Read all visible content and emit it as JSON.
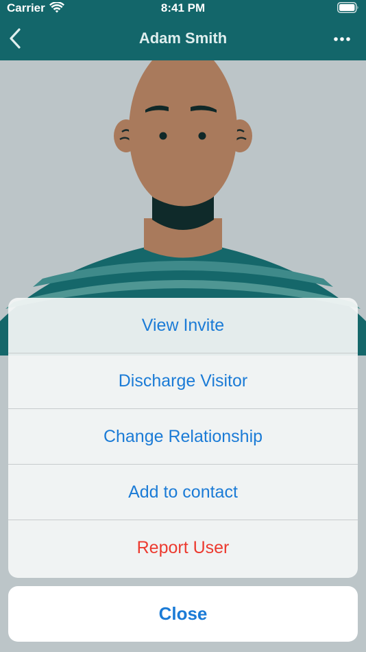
{
  "status_bar": {
    "carrier": "Carrier",
    "time": "8:41 PM",
    "wifi_icon": "wifi-icon",
    "battery_icon": "battery-icon"
  },
  "nav": {
    "title": "Adam Smith",
    "back_icon": "chevron-left-icon",
    "more_icon": "ellipsis-icon"
  },
  "colors": {
    "header_bg": "#13666a",
    "background": "#bcc5c8",
    "action_text": "#1b7bd6",
    "destructive_text": "#ec3a2f"
  },
  "action_sheet": {
    "actions": [
      {
        "label": "View Invite",
        "style": "default"
      },
      {
        "label": "Discharge Visitor",
        "style": "default"
      },
      {
        "label": "Change Relationship",
        "style": "default"
      },
      {
        "label": "Add to contact",
        "style": "default"
      },
      {
        "label": "Report User",
        "style": "destructive"
      }
    ],
    "cancel_label": "Close"
  }
}
